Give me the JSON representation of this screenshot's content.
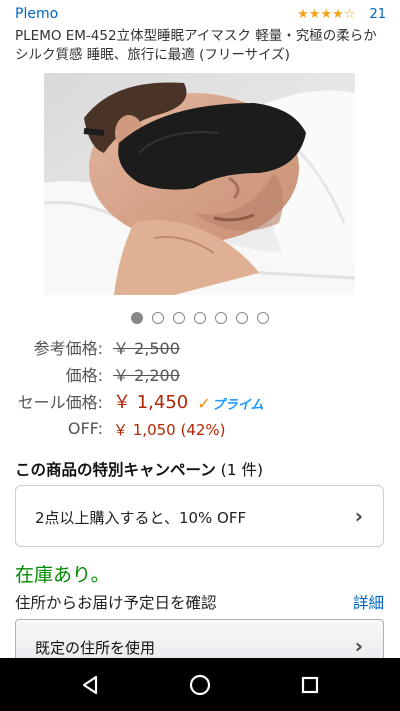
{
  "header": {
    "brand": "Plemo",
    "stars": "★★★★☆",
    "rating_count": "21"
  },
  "product": {
    "title": "PLEMO EM-452立体型睡眠アイマスク 軽量・究極の柔らかシルク質感 睡眠、旅行に最適 (フリーサイズ)",
    "image_icon": "product-photo-eye-mask",
    "image_dots": 7,
    "active_dot": 0
  },
  "prices": {
    "reference_label": "参考価格:",
    "reference_value": "￥ 2,500",
    "price_label": "価格:",
    "price_value": "￥ 2,200",
    "sale_label": "セール価格:",
    "sale_value": "￥ 1,450",
    "prime_label": "プライム",
    "off_label": "OFF:",
    "off_value": "￥ 1,050 (42%)"
  },
  "campaign": {
    "heading": "この商品の特別キャンペーン",
    "count": "(1 件)",
    "offer": "2点以上購入すると、10% OFF"
  },
  "availability": {
    "stock": "在庫あり。",
    "delivery_label": "住所からお届け予定日を確認",
    "details_link": "詳細",
    "address_button": "既定の住所を使用"
  },
  "colors": {
    "link": "#0066c0",
    "price": "#b12704",
    "stock": "#008a00",
    "star": "#f0a41c",
    "prime": "#1a98ff"
  }
}
